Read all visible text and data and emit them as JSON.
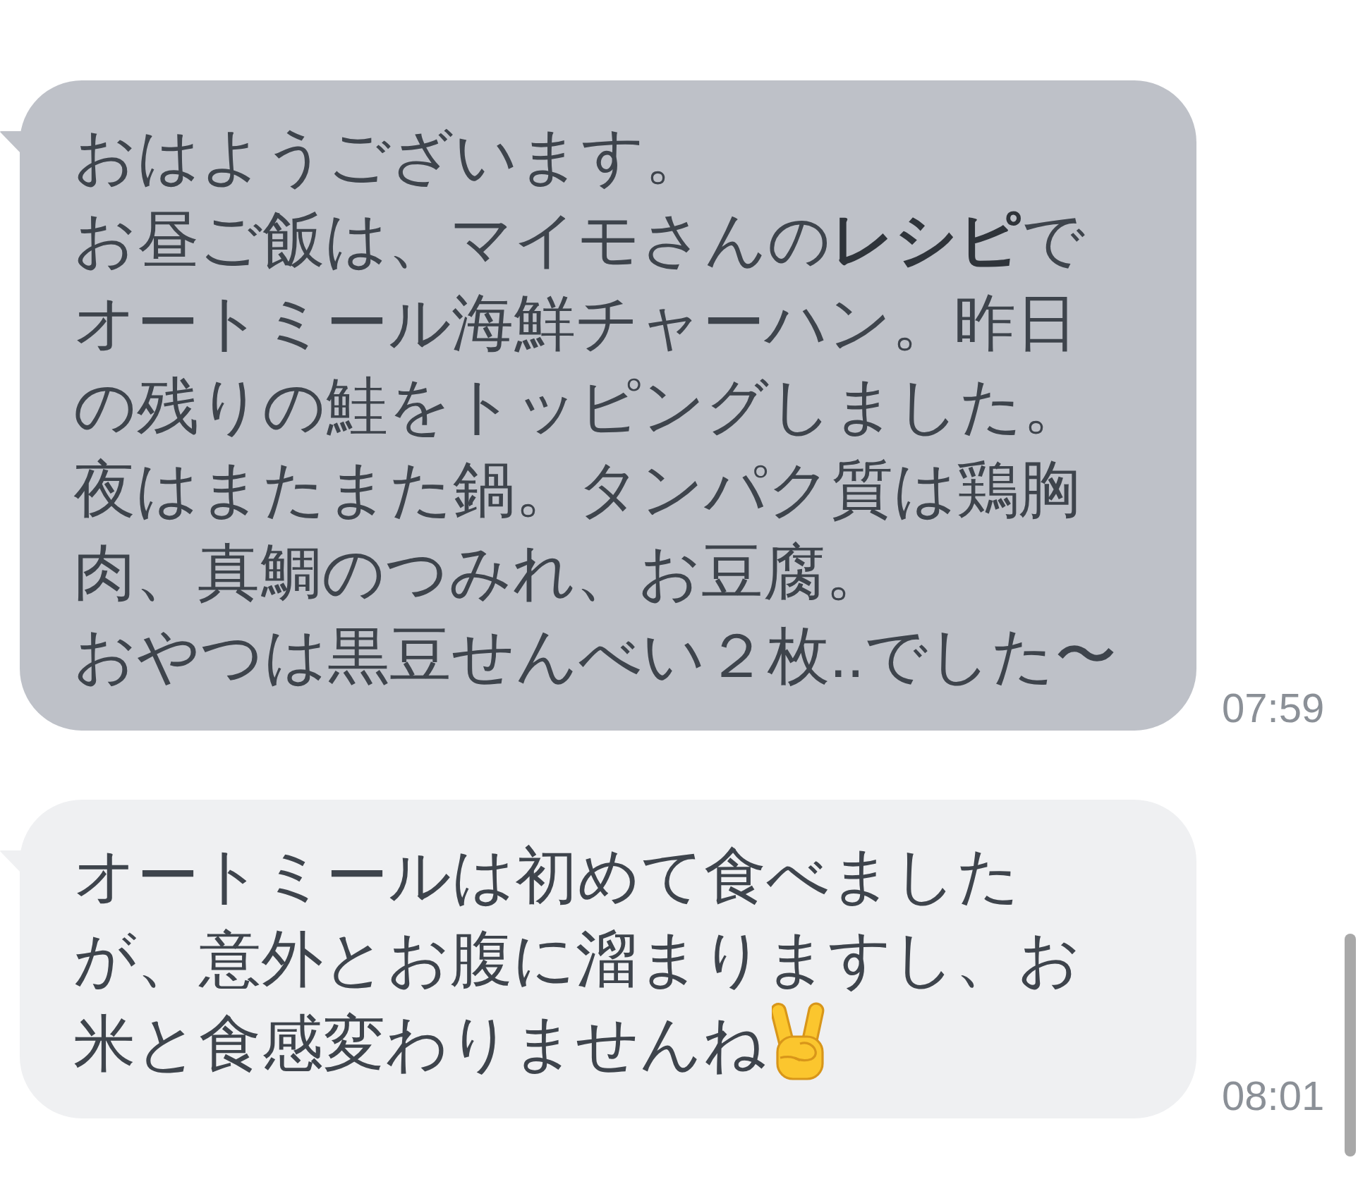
{
  "messages": [
    {
      "highlighted": true,
      "paragraphs": [
        "おはようございます。",
        "お昼ご飯は、マイモさんの**レシピ**で",
        "オートミール海鮮チャーハン。昨日の残りの鮭をトッピングしました。",
        "夜はまたまた鍋。タンパク質は鶏胸肉、真鯛のつみれ、お豆腐。",
        "おやつは黒豆せんべい２枚..でした〜"
      ],
      "trailing_emoji": false,
      "time": "07:59"
    },
    {
      "highlighted": false,
      "paragraphs": [
        "オートミールは初めて食べましたが、意外とお腹に溜まりますし、お米と食感変わりませんね"
      ],
      "trailing_emoji": true,
      "time": "08:01"
    }
  ]
}
